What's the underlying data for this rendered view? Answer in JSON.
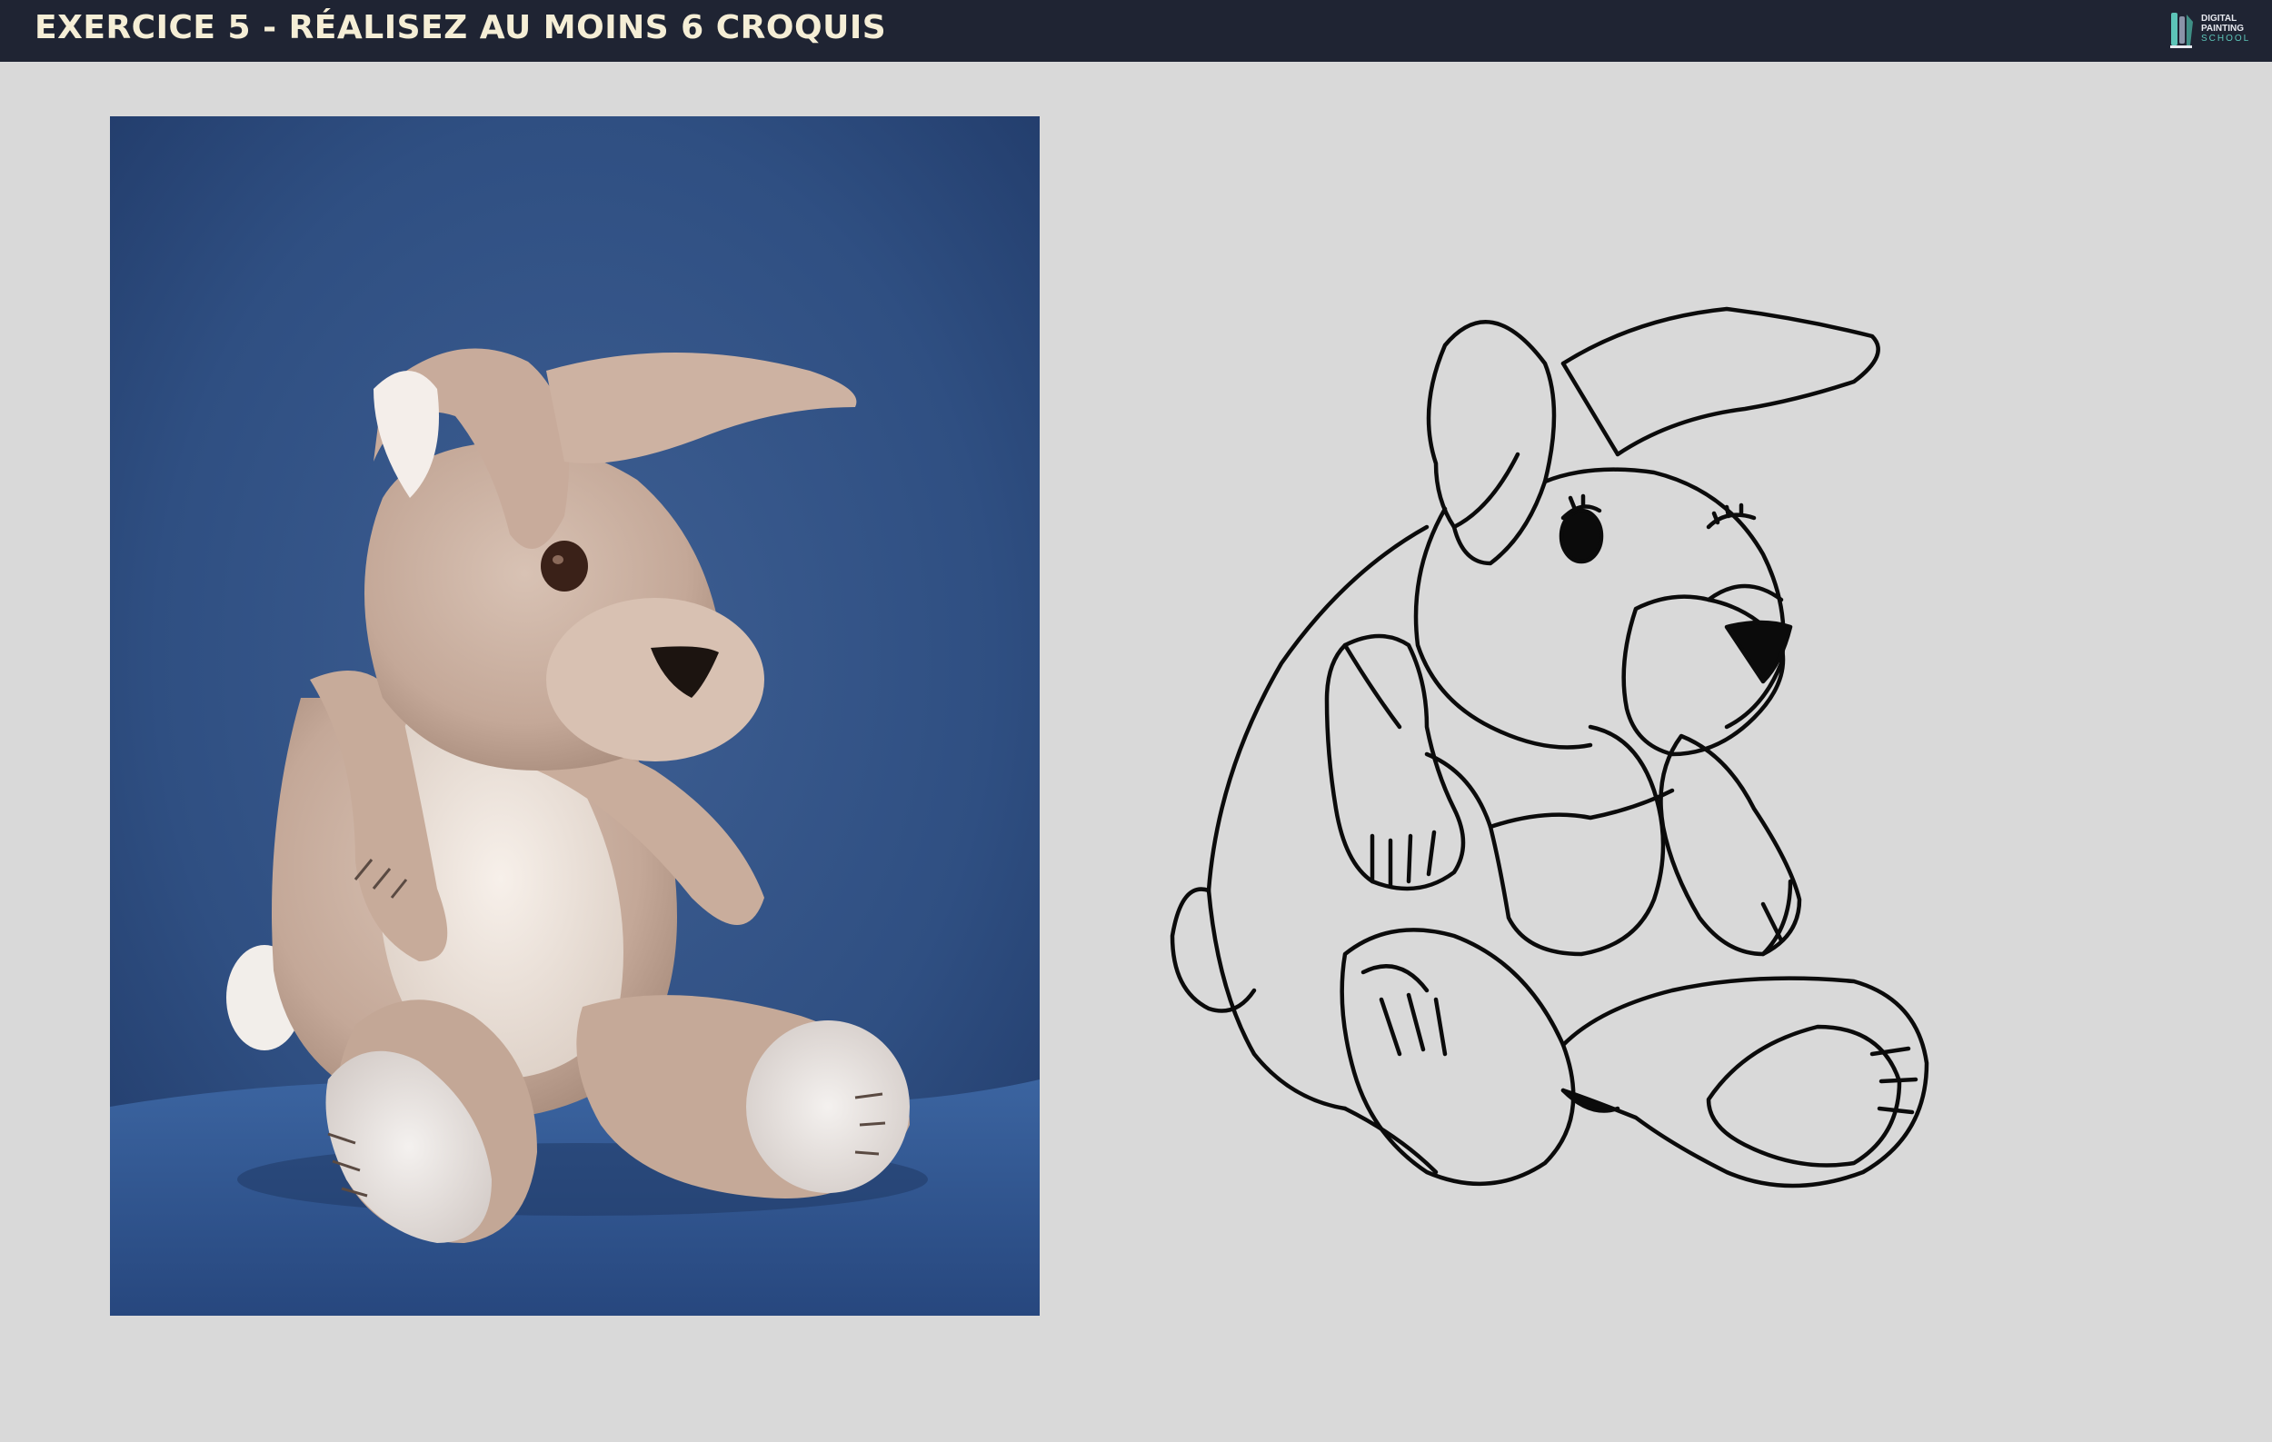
{
  "header": {
    "title": "EXERCICE 5 - RÉALISEZ AU MOINS 6 CROQUIS",
    "logo_line1": "DIGITAL",
    "logo_line2": "PAINTING",
    "logo_line3": "SCHOOL"
  },
  "colors": {
    "header_bg": "#1f2433",
    "title_text": "#f5eed6",
    "page_bg": "#d9d9d9",
    "accent": "#5cc4b8"
  },
  "photo": {
    "subject": "plush-rabbit-photo"
  },
  "sketch": {
    "subject": "plush-rabbit-line-drawing"
  }
}
